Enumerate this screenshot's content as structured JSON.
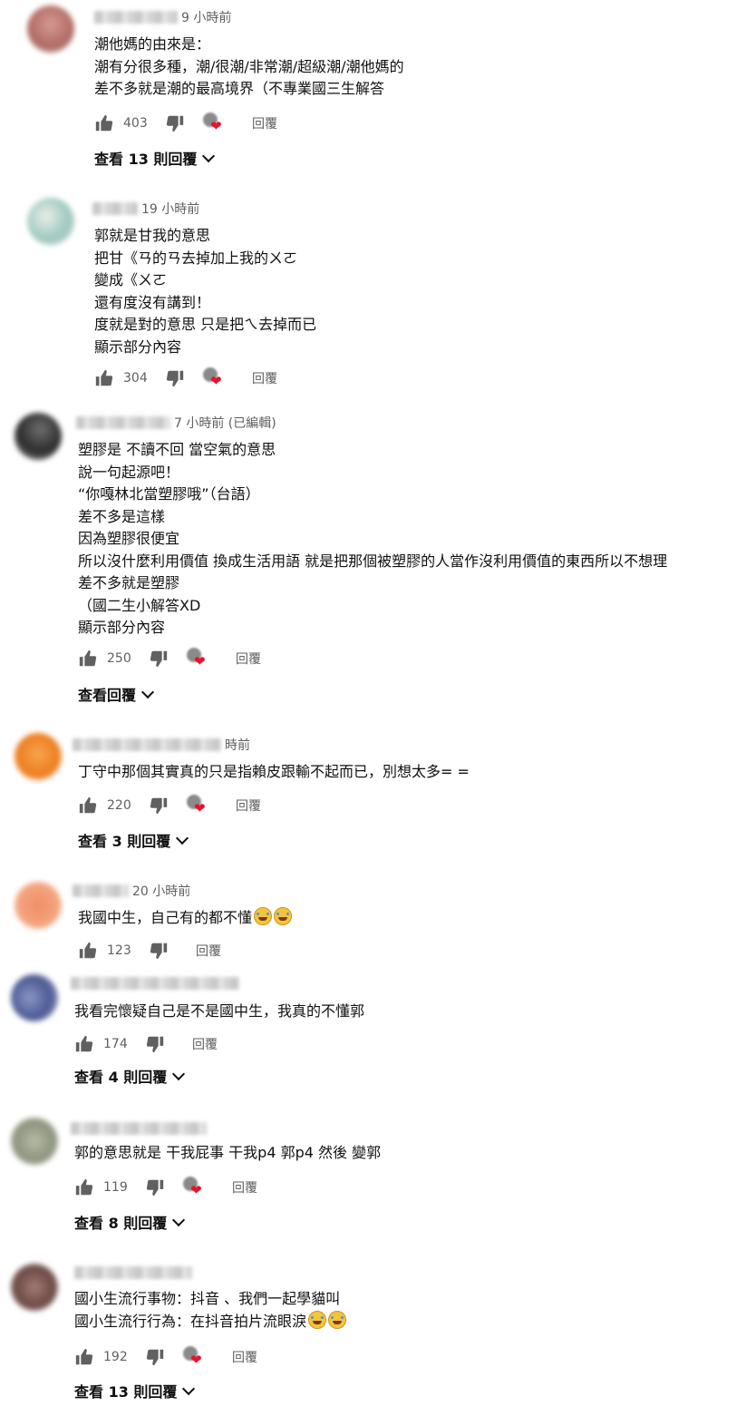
{
  "comments": [
    {
      "time": "9 小時前",
      "lines": [
        "潮他媽的由來是：",
        "潮有分很多種，潮/很潮/非常潮/超級潮/潮他媽的",
        "差不多就是潮的最高境界（不專業國三生解答"
      ],
      "likes": "403",
      "reply_label": "回覆",
      "view_replies": "查看 13 則回覆",
      "hearted": true,
      "avatar_color": "#b06a63"
    },
    {
      "time": "19 小時前",
      "lines": [
        "郭就是甘我的意思",
        "把甘《ㄢ的ㄢ去掉加上我的ㄨㄛ",
        "變成《ㄨㄛ",
        "還有度沒有講到！",
        "度就是對的意思 只是把ㄟ去掉而已",
        "顯示部分內容"
      ],
      "likes": "304",
      "reply_label": "回覆",
      "hearted": true,
      "avatar_color": "#9fc9c0"
    },
    {
      "time": "7 小時前 (已編輯)",
      "lines": [
        "塑膠是 不讀不回 當空氣的意思",
        "說一句起源吧！",
        "“你嘎林北當塑膠哦”（台語）",
        "差不多是這樣",
        "因為塑膠很便宜",
        "所以沒什麼利用價值 換成生活用語 就是把那個被塑膠的人當作沒利用價值的東西所以不想理",
        "差不多就是塑膠",
        "（國二生小解答XD",
        "顯示部分內容"
      ],
      "likes": "250",
      "reply_label": "回覆",
      "view_replies": "查看回覆",
      "hearted": true,
      "avatar_color": "#3a3a3a"
    },
    {
      "time": "時前",
      "lines": [
        "丁守中那個其實真的只是指賴皮跟輸不起而已，別想太多= ="
      ],
      "likes": "220",
      "reply_label": "回覆",
      "view_replies": "查看 3 則回覆",
      "hearted": true,
      "avatar_color": "#f08a2c"
    },
    {
      "time": "20 小時前",
      "lines": [
        "我國中生，自己有的都不懂"
      ],
      "likes": "123",
      "reply_label": "回覆",
      "hearted": false,
      "avatar_color": "#f3a27b"
    },
    {
      "time": "",
      "lines": [
        "我看完懷疑自己是不是國中生，我真的不懂郭"
      ],
      "likes": "174",
      "reply_label": "回覆",
      "view_replies": "查看 4 則回覆",
      "hearted": false,
      "avatar_color": "#5a6a9e"
    },
    {
      "time": "",
      "lines": [
        "郭的意思就是 干我屁事 干我p4 郭p4 然後 變郭"
      ],
      "likes": "119",
      "reply_label": "回覆",
      "view_replies": "查看 8 則回覆",
      "hearted": true,
      "avatar_color": "#9aa08c"
    },
    {
      "time": "",
      "lines": [
        "國小生流行事物：抖音 、我們一起學貓叫",
        "國小生流行行為：在抖音拍片流眼淚"
      ],
      "likes": "192",
      "reply_label": "回覆",
      "view_replies": "查看 13 則回覆",
      "hearted": true,
      "avatar_color": "#7a5550"
    }
  ]
}
